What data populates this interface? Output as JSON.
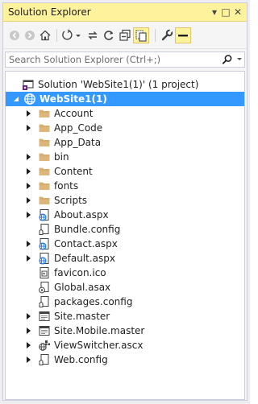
{
  "window": {
    "title": "Solution Explorer",
    "ctrl_dropdown": "▾",
    "ctrl_maximize": "□",
    "ctrl_close": "✕"
  },
  "toolbar": {
    "buttons": [
      "back",
      "forward",
      "home",
      "pending-changes",
      "sync",
      "refresh",
      "collapse-all",
      "show-all-files",
      "properties",
      "preview"
    ]
  },
  "search": {
    "placeholder": "Search Solution Explorer (Ctrl+;)"
  },
  "tree": {
    "solution": "Solution 'WebSite1(1)' (1 project)",
    "project": "WebSite1(1)",
    "items": [
      {
        "label": "Account",
        "icon": "folder-icon",
        "expandable": true
      },
      {
        "label": "App_Code",
        "icon": "folder-icon",
        "expandable": true
      },
      {
        "label": "App_Data",
        "icon": "folder-icon",
        "expandable": false
      },
      {
        "label": "bin",
        "icon": "folder-icon",
        "expandable": true
      },
      {
        "label": "Content",
        "icon": "folder-icon",
        "expandable": true
      },
      {
        "label": "fonts",
        "icon": "folder-icon",
        "expandable": true
      },
      {
        "label": "Scripts",
        "icon": "folder-icon",
        "expandable": true
      },
      {
        "label": "About.aspx",
        "icon": "aspx-icon",
        "expandable": true
      },
      {
        "label": "Bundle.config",
        "icon": "config-icon",
        "expandable": false
      },
      {
        "label": "Contact.aspx",
        "icon": "aspx-icon",
        "expandable": true
      },
      {
        "label": "Default.aspx",
        "icon": "aspx-icon",
        "expandable": true
      },
      {
        "label": "favicon.ico",
        "icon": "ico-icon",
        "expandable": false
      },
      {
        "label": "Global.asax",
        "icon": "asax-icon",
        "expandable": false
      },
      {
        "label": "packages.config",
        "icon": "config-icon",
        "expandable": false
      },
      {
        "label": "Site.master",
        "icon": "master-icon",
        "expandable": true
      },
      {
        "label": "Site.Mobile.master",
        "icon": "master-icon",
        "expandable": true
      },
      {
        "label": "ViewSwitcher.ascx",
        "icon": "ascx-icon",
        "expandable": true
      },
      {
        "label": "Web.config",
        "icon": "config-icon",
        "expandable": true
      }
    ]
  },
  "colors": {
    "selection": "#3399ff",
    "title_bar": "#fff29d",
    "folder": "#dcb67a"
  }
}
